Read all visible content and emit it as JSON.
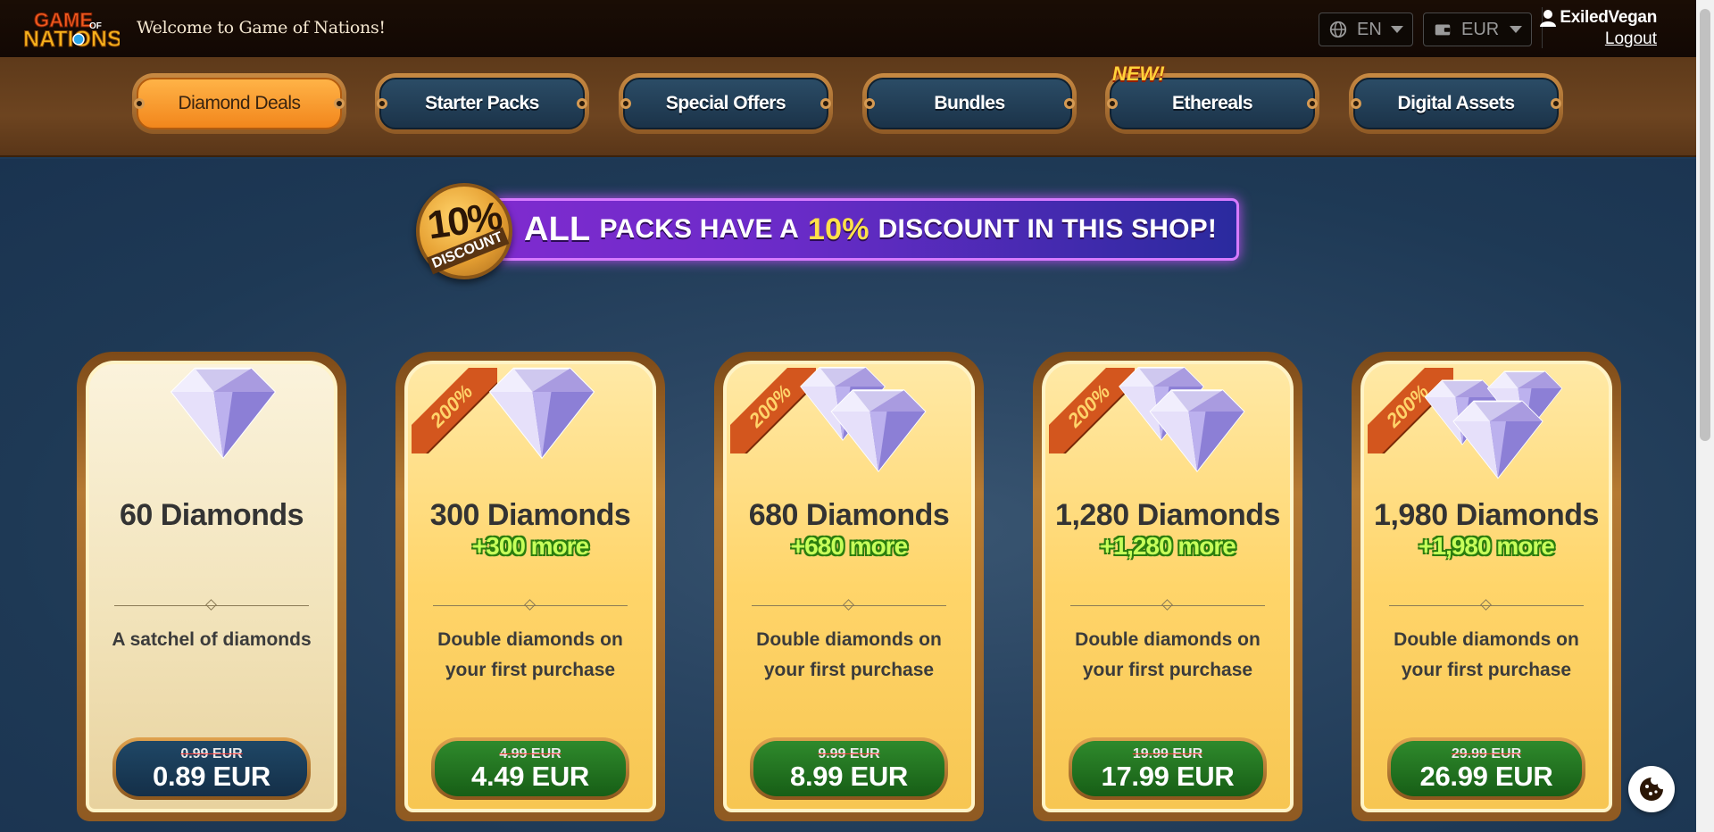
{
  "header": {
    "logo_text": [
      "GAME",
      "OF",
      "NATIONS"
    ],
    "welcome": "Welcome to Game of Nations!",
    "language": "EN",
    "currency": "EUR",
    "username": "ExiledVegan",
    "logout": "Logout"
  },
  "tabs": [
    {
      "label": "Diamond Deals",
      "active": true
    },
    {
      "label": "Starter Packs",
      "active": false
    },
    {
      "label": "Special Offers",
      "active": false
    },
    {
      "label": "Bundles",
      "active": false
    },
    {
      "label": "Ethereals",
      "active": false,
      "tag": "NEW!"
    },
    {
      "label": "Digital Assets",
      "active": false
    }
  ],
  "banner": {
    "badge_percent": "10%",
    "badge_label": "DISCOUNT",
    "text_all": "ALL",
    "text_mid": "PACKS HAVE A",
    "text_pct": "10%",
    "text_end": "DISCOUNT IN THIS SHOP!"
  },
  "cards": [
    {
      "title": "60 Diamonds",
      "bonus": "",
      "ribbon": "",
      "desc": "A satchel of diamonds",
      "old_price": "0.99 EUR",
      "price": "0.89 EUR"
    },
    {
      "title": "300 Diamonds",
      "bonus": "+300 more",
      "ribbon": "200%",
      "desc": "Double diamonds on your first purchase",
      "old_price": "4.99 EUR",
      "price": "4.49 EUR"
    },
    {
      "title": "680 Diamonds",
      "bonus": "+680 more",
      "ribbon": "200%",
      "desc": "Double diamonds on your first purchase",
      "old_price": "9.99 EUR",
      "price": "8.99 EUR"
    },
    {
      "title": "1,280 Diamonds",
      "bonus": "+1,280 more",
      "ribbon": "200%",
      "desc": "Double diamonds on your first purchase",
      "old_price": "19.99 EUR",
      "price": "17.99 EUR"
    },
    {
      "title": "1,980 Diamonds",
      "bonus": "+1,980 more",
      "ribbon": "200%",
      "desc": "Double diamonds on your first purchase",
      "old_price": "29.99 EUR",
      "price": "26.99 EUR"
    }
  ],
  "colors": {
    "tab_active": "#f2861c",
    "tab_inactive": "#1b3349",
    "price_green": "#175e16",
    "bonus_green": "#c7ff5a",
    "banner_purple": "#7f2bcf"
  },
  "icons": {
    "language": "globe-icon",
    "currency": "wallet-icon",
    "user": "user-icon",
    "cookie": "cookie-icon",
    "card_image": "diamond-icon"
  }
}
